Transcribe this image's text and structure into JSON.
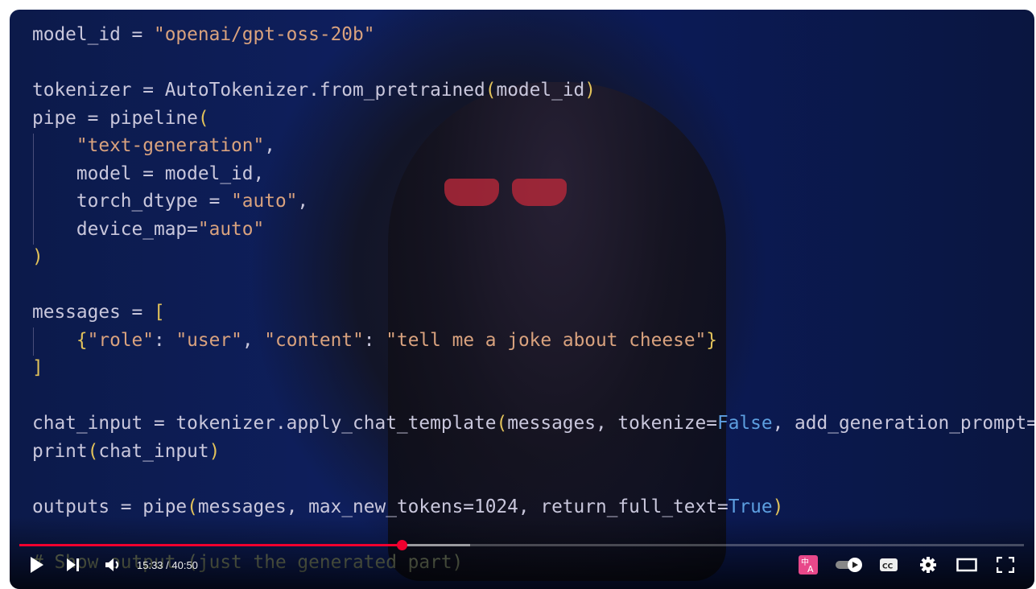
{
  "code_lines": [
    [
      {
        "t": "model_id = "
      },
      {
        "t": "\"openai/gpt-oss-20b\"",
        "c": "s"
      }
    ],
    [],
    [
      {
        "t": "tokenizer = AutoTokenizer.from_pretrained"
      },
      {
        "t": "(",
        "c": "b"
      },
      {
        "t": "model_id"
      },
      {
        "t": ")",
        "c": "b"
      }
    ],
    [
      {
        "t": "pipe = pipeline"
      },
      {
        "t": "(",
        "c": "b"
      }
    ],
    [
      {
        "t": "    "
      },
      {
        "t": "\"text-generation\"",
        "c": "s"
      },
      {
        "t": ","
      }
    ],
    [
      {
        "t": "    model = model_id,"
      }
    ],
    [
      {
        "t": "    torch_dtype = "
      },
      {
        "t": "\"auto\"",
        "c": "s"
      },
      {
        "t": ","
      }
    ],
    [
      {
        "t": "    device_map="
      },
      {
        "t": "\"auto\"",
        "c": "s"
      }
    ],
    [
      {
        "t": ")",
        "c": "b"
      }
    ],
    [],
    [
      {
        "t": "messages = "
      },
      {
        "t": "[",
        "c": "b"
      }
    ],
    [
      {
        "t": "    "
      },
      {
        "t": "{",
        "c": "b"
      },
      {
        "t": "\"role\"",
        "c": "s"
      },
      {
        "t": ": "
      },
      {
        "t": "\"user\"",
        "c": "s"
      },
      {
        "t": ", "
      },
      {
        "t": "\"content\"",
        "c": "s"
      },
      {
        "t": ": "
      },
      {
        "t": "\"tell me a joke about cheese\"",
        "c": "s"
      },
      {
        "t": "}",
        "c": "b"
      }
    ],
    [
      {
        "t": "]",
        "c": "b"
      }
    ],
    [],
    [
      {
        "t": "chat_input = tokenizer.apply_chat_template"
      },
      {
        "t": "(",
        "c": "b"
      },
      {
        "t": "messages, tokenize="
      },
      {
        "t": "False",
        "c": "k"
      },
      {
        "t": ", add_generation_prompt="
      }
    ],
    [
      {
        "t": "print"
      },
      {
        "t": "(",
        "c": "b"
      },
      {
        "t": "chat_input"
      },
      {
        "t": ")",
        "c": "b"
      }
    ],
    [],
    [
      {
        "t": "outputs = pipe"
      },
      {
        "t": "(",
        "c": "b"
      },
      {
        "t": "messages, max_new_tokens=1024, return_full_text="
      },
      {
        "t": "True",
        "c": "k"
      },
      {
        "t": ")",
        "c": "b"
      }
    ],
    [],
    [
      {
        "t": "# Show output (just the generated part)",
        "c": "c"
      }
    ]
  ],
  "player": {
    "current_time": "15:33",
    "duration": "40:50",
    "time_display": "15:33 / 40:50",
    "progress_fraction": 0.381,
    "buffered_fraction": 0.449,
    "accent_color": "#f0002e",
    "controls": [
      "play-icon",
      "next-icon",
      "volume-icon",
      "auto-dub-icon",
      "autoplay-toggle",
      "captions-icon",
      "settings-icon",
      "theater-mode-icon",
      "fullscreen-icon"
    ],
    "autoplay_on": true
  }
}
